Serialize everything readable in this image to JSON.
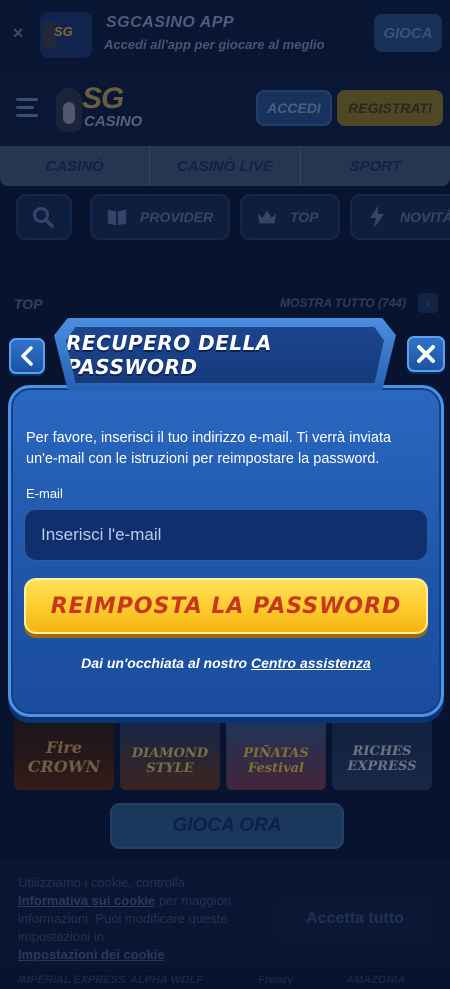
{
  "app_banner": {
    "close": "×",
    "title": "SGCASINO APP",
    "subtitle": "Accedi all'app per giocare al meglio",
    "play_label": "GIOCA"
  },
  "header": {
    "logo_sg": "SG",
    "logo_casino": "CASINO",
    "login_label": "ACCEDI",
    "register_label": "REGISTRATI"
  },
  "categories": [
    "CASINÒ",
    "CASINÒ LIVE",
    "SPORT"
  ],
  "chips": [
    {
      "label": "",
      "icon": "search-icon"
    },
    {
      "label": "PROVIDER",
      "icon": "book-icon"
    },
    {
      "label": "TOP",
      "icon": "crown-icon"
    },
    {
      "label": "NOVITÀ",
      "icon": "lightning-icon"
    }
  ],
  "section": {
    "title": "TOP",
    "show_all": "MOSTRA TUTTO (744)",
    "arrow": "›"
  },
  "games": [
    "Fire CROWN",
    "DIAMOND STYLE",
    "PIÑATAS Festival",
    "RICHES EXPRESS"
  ],
  "play_now": "GIOCA ORA",
  "cookie": {
    "text_1": "Utilizziamo i cookie, controlla",
    "link_1": "Informativa sui cookie",
    "text_2": "per maggiori informazioni. Puoi modificare queste impostazioni in",
    "link_2": "Impostazioni dei cookie",
    "accept": "Accetta tutto"
  },
  "bottom_games": [
    "IMPERIAL EXPRESS",
    "ALPHA WOLF",
    "Frenzy",
    "AMAZONIA"
  ],
  "modal": {
    "back_icon": "chevron-left-icon",
    "close_icon": "close-icon",
    "title": "RECUPERO DELLA PASSWORD",
    "description": "Per favore, inserisci il tuo indirizzo e-mail. Ti verrà inviata un'e-mail con le istruzioni per reimpostare la password.",
    "email_label": "E-mail",
    "email_placeholder": "Inserisci l'e-mail",
    "email_value": "",
    "submit_label": "REIMPOSTA LA PASSWORD",
    "help_prefix": "Dai un'occhiata al nostro",
    "help_link": "Centro assistenza"
  },
  "colors": {
    "panel": "#1e55a8",
    "button_yellow": "#fdcb2c",
    "button_text": "#c8361d"
  }
}
